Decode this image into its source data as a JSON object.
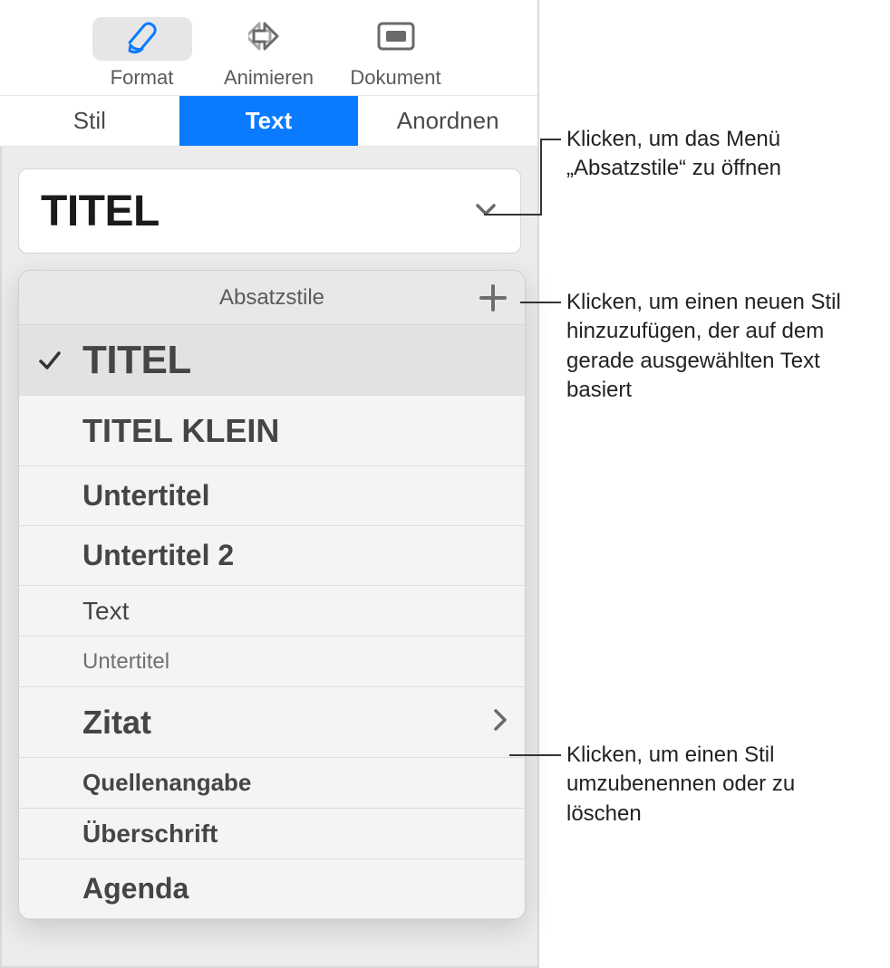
{
  "toolbar": {
    "format": "Format",
    "animate": "Animieren",
    "document": "Dokument"
  },
  "subtabs": {
    "style": "Stil",
    "text": "Text",
    "arrange": "Anordnen"
  },
  "selector": {
    "current": "TITEL"
  },
  "popover": {
    "title": "Absatzstile",
    "items": [
      {
        "label": "TITEL",
        "selected": true,
        "arrow": false,
        "cls": "st-titel",
        "h": ""
      },
      {
        "label": "TITEL KLEIN",
        "selected": false,
        "arrow": false,
        "cls": "st-titelklein",
        "h": ""
      },
      {
        "label": "Untertitel",
        "selected": false,
        "arrow": false,
        "cls": "st-untertitel1",
        "h": "short"
      },
      {
        "label": "Untertitel 2",
        "selected": false,
        "arrow": false,
        "cls": "st-untertitel2",
        "h": "short"
      },
      {
        "label": "Text",
        "selected": false,
        "arrow": false,
        "cls": "st-text",
        "h": "shorter"
      },
      {
        "label": "Untertitel",
        "selected": false,
        "arrow": false,
        "cls": "st-untertitel3",
        "h": "shorter"
      },
      {
        "label": "Zitat",
        "selected": false,
        "arrow": true,
        "cls": "st-zitat",
        "h": ""
      },
      {
        "label": "Quellenangabe",
        "selected": false,
        "arrow": false,
        "cls": "st-quelle",
        "h": "shorter"
      },
      {
        "label": "Überschrift",
        "selected": false,
        "arrow": false,
        "cls": "st-uber",
        "h": "shorter"
      },
      {
        "label": "Agenda",
        "selected": false,
        "arrow": false,
        "cls": "st-agenda",
        "h": "short"
      }
    ]
  },
  "callouts": {
    "c1": "Klicken, um das Menü „Absatzstile“ zu öffnen",
    "c2": "Klicken, um einen neuen Stil hinzuzufügen, der auf dem gerade ausgewählten Text basiert",
    "c3": "Klicken, um einen Stil umzubenennen oder zu löschen"
  }
}
